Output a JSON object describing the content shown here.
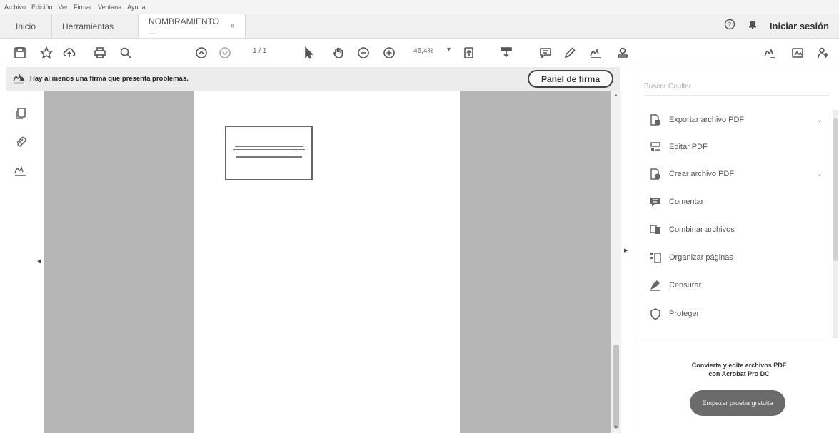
{
  "menubar": {
    "items": [
      "Archivo",
      "Edición",
      "Ver",
      "Firmar",
      "Ventana",
      "Ayuda"
    ]
  },
  "tabs": {
    "home": "Inicio",
    "tools": "Herramientas",
    "document": "NOMBRAMIENTO ...",
    "close_glyph": "×"
  },
  "header": {
    "sign_in": "Iniciar sesión"
  },
  "toolbar": {
    "page_indicator": "1 / 1",
    "zoom": "46,4%"
  },
  "notice": {
    "text": "Hay al menos una firma que presenta problemas.",
    "button": "Panel de firma"
  },
  "sidepane": {
    "search_placeholder": "Buscar Ocultar",
    "tools": [
      {
        "label": "Exportar archivo PDF",
        "icon": "export-pdf-icon",
        "expandable": true
      },
      {
        "label": "Editar PDF",
        "icon": "edit-pdf-icon",
        "expandable": false
      },
      {
        "label": "Crear archivo PDF",
        "icon": "create-pdf-icon",
        "expandable": true
      },
      {
        "label": "Comentar",
        "icon": "comment-icon",
        "expandable": false
      },
      {
        "label": "Combinar archivos",
        "icon": "combine-icon",
        "expandable": false
      },
      {
        "label": "Organizar páginas",
        "icon": "organize-icon",
        "expandable": false
      },
      {
        "label": "Censurar",
        "icon": "redact-icon",
        "expandable": false
      },
      {
        "label": "Proteger",
        "icon": "protect-icon",
        "expandable": false
      }
    ],
    "promo_line1": "Convierta y edite archivos PDF",
    "promo_line2": "con Acrobat Pro DC",
    "trial_button": "Empezar prueba gratuita"
  },
  "colors": {
    "page_margin": "#b6b6b6",
    "notice_bg": "#ececec",
    "trial_button": "#6b6b6b"
  }
}
